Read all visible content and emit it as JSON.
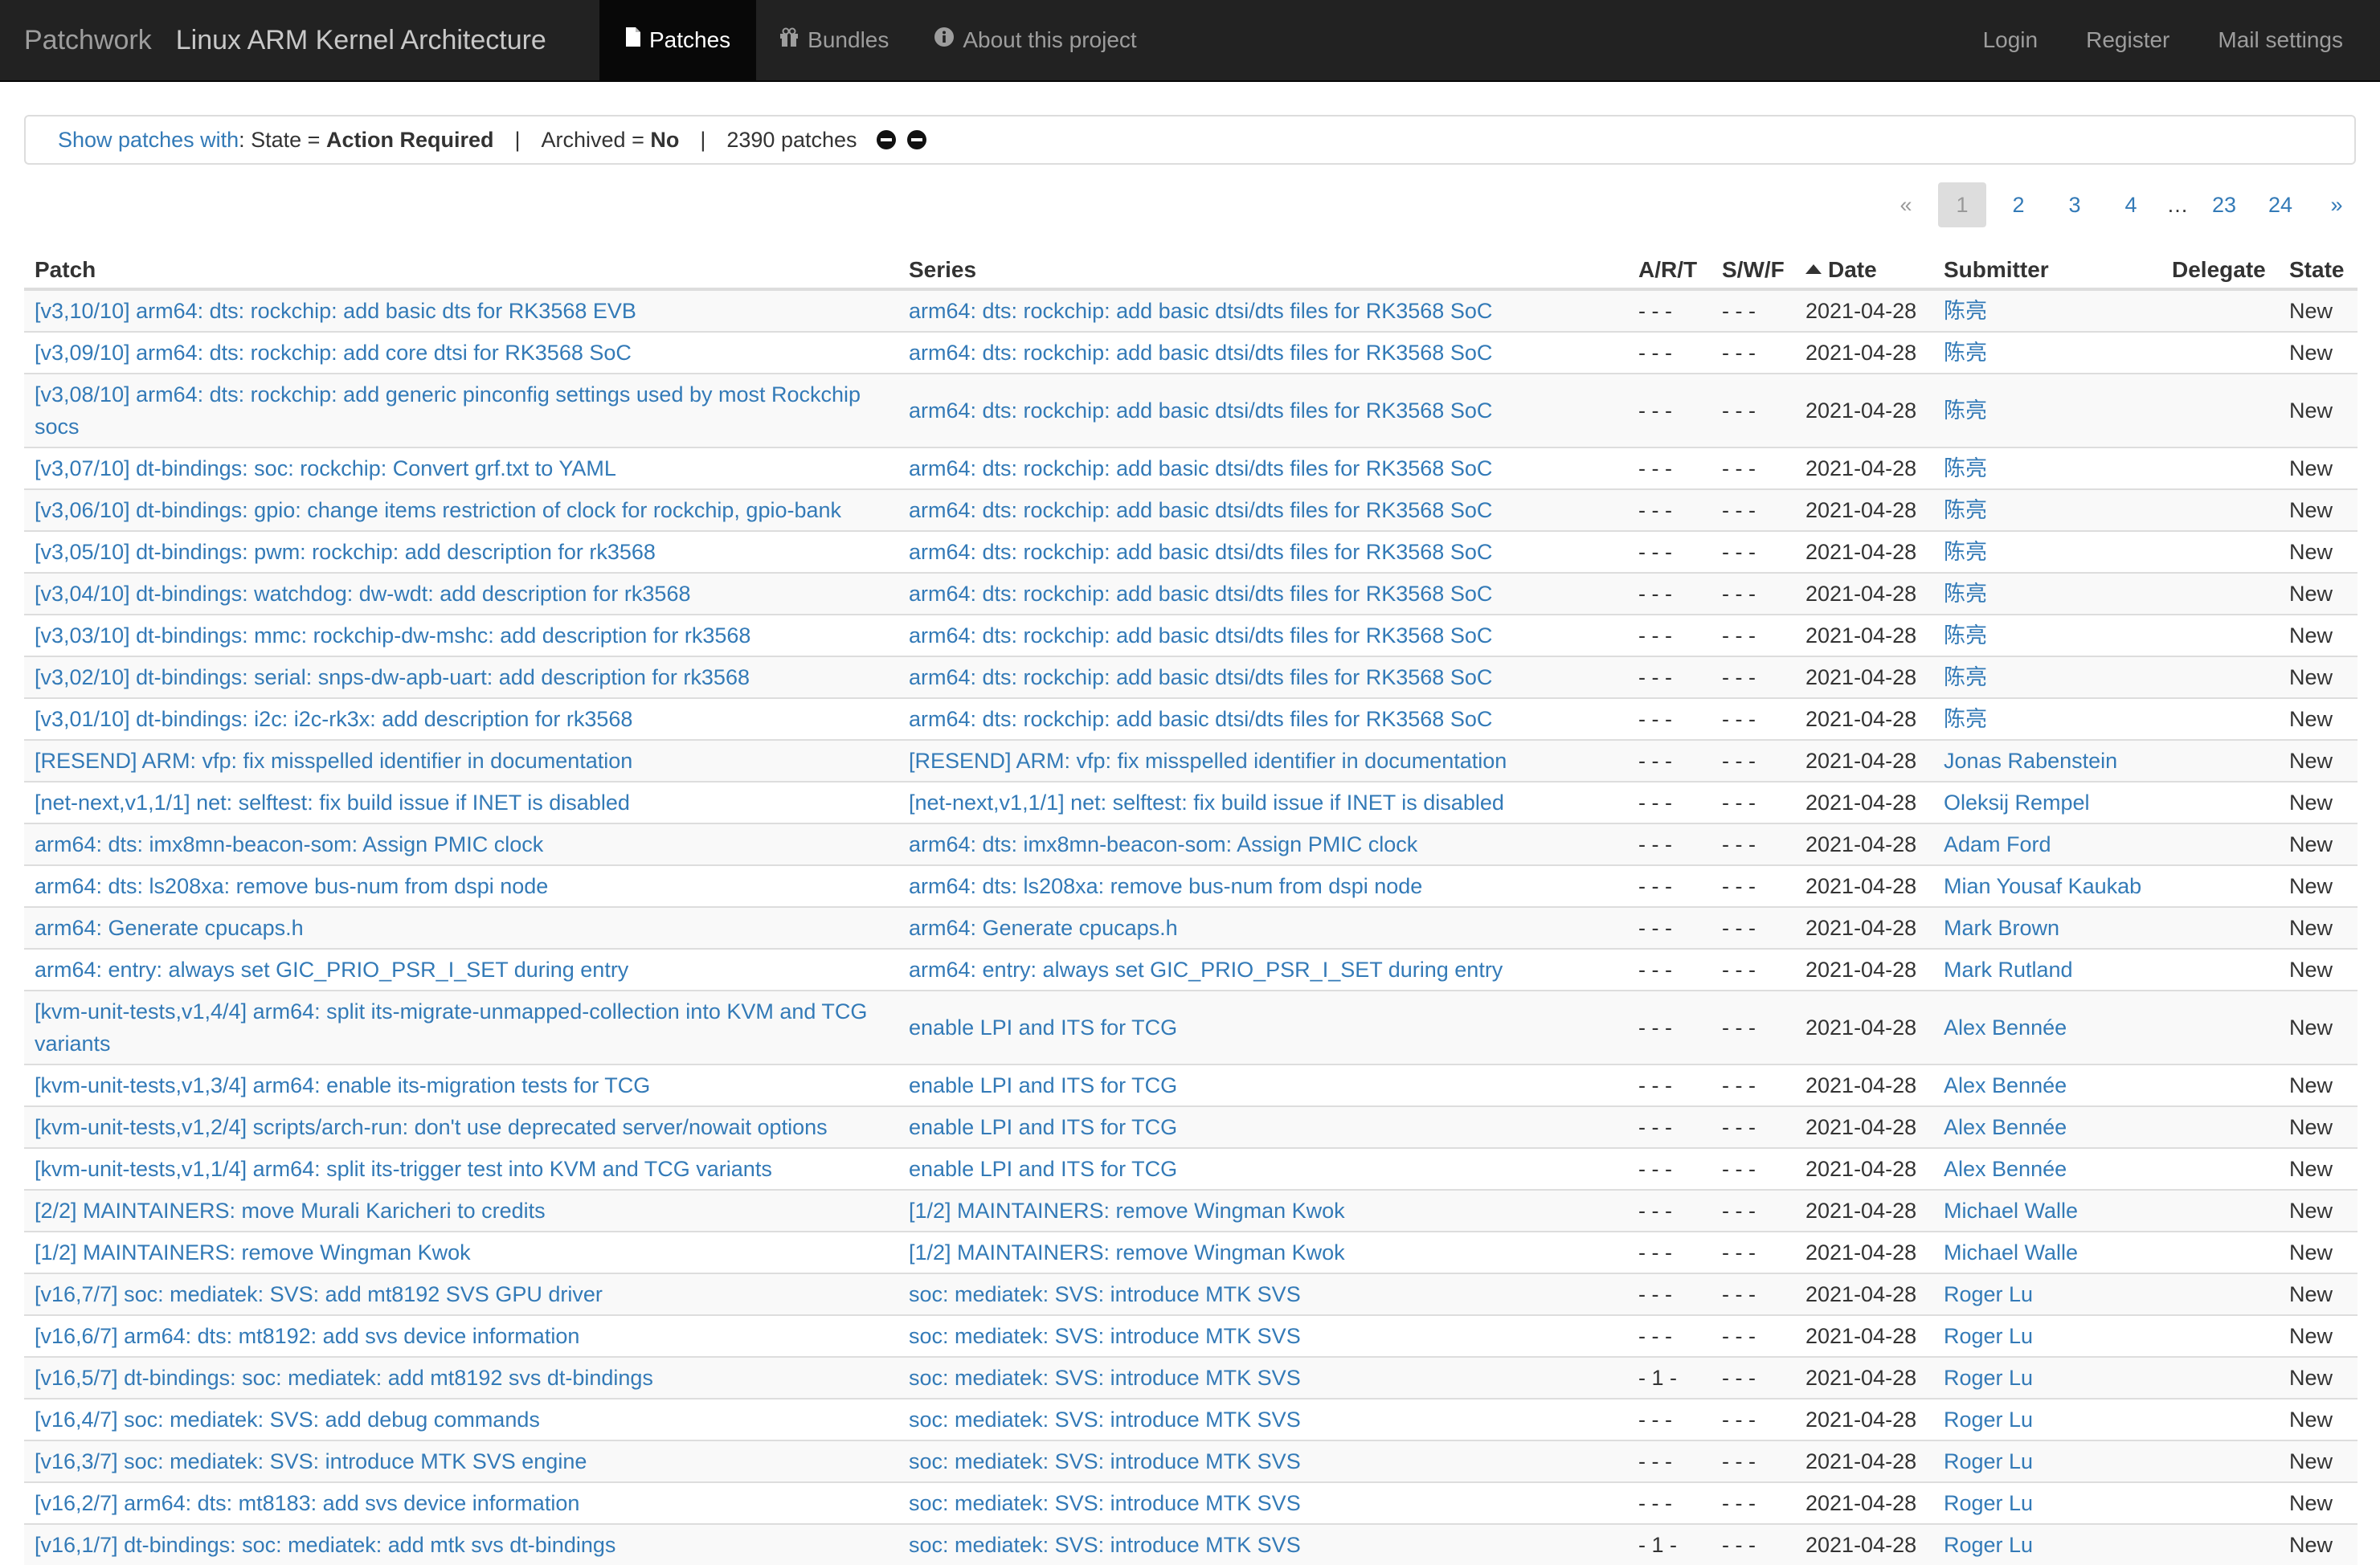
{
  "nav": {
    "site_name": "Patchwork",
    "project_name": "Linux ARM Kernel Architecture",
    "tabs": [
      {
        "label": "Patches",
        "icon": "file-icon",
        "active": true
      },
      {
        "label": "Bundles",
        "icon": "gift-icon",
        "active": false
      },
      {
        "label": "About this project",
        "icon": "info-icon",
        "active": false
      }
    ],
    "right": [
      {
        "label": "Login"
      },
      {
        "label": "Register"
      },
      {
        "label": "Mail settings"
      }
    ]
  },
  "filters": {
    "prefix": "Show patches with",
    "state_label": "State =",
    "state_value": "Action Required",
    "archived_label": "Archived =",
    "archived_value": "No",
    "count": "2390 patches"
  },
  "pagination": {
    "prev": "«",
    "pages": [
      "1",
      "2",
      "3",
      "4"
    ],
    "ellipsis": "…",
    "tail_pages": [
      "23",
      "24"
    ],
    "next": "»",
    "current": "1"
  },
  "table": {
    "headers": {
      "patch": "Patch",
      "series": "Series",
      "art": "A/R/T",
      "swf": "S/W/F",
      "date": "Date",
      "submitter": "Submitter",
      "delegate": "Delegate",
      "state": "State"
    },
    "rows": [
      {
        "patch": "[v3,10/10] arm64: dts: rockchip: add basic dts for RK3568 EVB",
        "series": "arm64: dts: rockchip: add basic dtsi/dts files for RK3568 SoC",
        "art": "- - -",
        "swf": "- - -",
        "date": "2021-04-28",
        "submitter": "陈亮",
        "delegate": "",
        "state": "New"
      },
      {
        "patch": "[v3,09/10] arm64: dts: rockchip: add core dtsi for RK3568 SoC",
        "series": "arm64: dts: rockchip: add basic dtsi/dts files for RK3568 SoC",
        "art": "- - -",
        "swf": "- - -",
        "date": "2021-04-28",
        "submitter": "陈亮",
        "delegate": "",
        "state": "New"
      },
      {
        "patch": "[v3,08/10] arm64: dts: rockchip: add generic pinconfig settings used by most Rockchip socs",
        "series": "arm64: dts: rockchip: add basic dtsi/dts files for RK3568 SoC",
        "art": "- - -",
        "swf": "- - -",
        "date": "2021-04-28",
        "submitter": "陈亮",
        "delegate": "",
        "state": "New"
      },
      {
        "patch": "[v3,07/10] dt-bindings: soc: rockchip: Convert grf.txt to YAML",
        "series": "arm64: dts: rockchip: add basic dtsi/dts files for RK3568 SoC",
        "art": "- - -",
        "swf": "- - -",
        "date": "2021-04-28",
        "submitter": "陈亮",
        "delegate": "",
        "state": "New"
      },
      {
        "patch": "[v3,06/10] dt-bindings: gpio: change items restriction of clock for rockchip, gpio-bank",
        "series": "arm64: dts: rockchip: add basic dtsi/dts files for RK3568 SoC",
        "art": "- - -",
        "swf": "- - -",
        "date": "2021-04-28",
        "submitter": "陈亮",
        "delegate": "",
        "state": "New"
      },
      {
        "patch": "[v3,05/10] dt-bindings: pwm: rockchip: add description for rk3568",
        "series": "arm64: dts: rockchip: add basic dtsi/dts files for RK3568 SoC",
        "art": "- - -",
        "swf": "- - -",
        "date": "2021-04-28",
        "submitter": "陈亮",
        "delegate": "",
        "state": "New"
      },
      {
        "patch": "[v3,04/10] dt-bindings: watchdog: dw-wdt: add description for rk3568",
        "series": "arm64: dts: rockchip: add basic dtsi/dts files for RK3568 SoC",
        "art": "- - -",
        "swf": "- - -",
        "date": "2021-04-28",
        "submitter": "陈亮",
        "delegate": "",
        "state": "New"
      },
      {
        "patch": "[v3,03/10] dt-bindings: mmc: rockchip-dw-mshc: add description for rk3568",
        "series": "arm64: dts: rockchip: add basic dtsi/dts files for RK3568 SoC",
        "art": "- - -",
        "swf": "- - -",
        "date": "2021-04-28",
        "submitter": "陈亮",
        "delegate": "",
        "state": "New"
      },
      {
        "patch": "[v3,02/10] dt-bindings: serial: snps-dw-apb-uart: add description for rk3568",
        "series": "arm64: dts: rockchip: add basic dtsi/dts files for RK3568 SoC",
        "art": "- - -",
        "swf": "- - -",
        "date": "2021-04-28",
        "submitter": "陈亮",
        "delegate": "",
        "state": "New"
      },
      {
        "patch": "[v3,01/10] dt-bindings: i2c: i2c-rk3x: add description for rk3568",
        "series": "arm64: dts: rockchip: add basic dtsi/dts files for RK3568 SoC",
        "art": "- - -",
        "swf": "- - -",
        "date": "2021-04-28",
        "submitter": "陈亮",
        "delegate": "",
        "state": "New"
      },
      {
        "patch": "[RESEND] ARM: vfp: fix misspelled identifier in documentation",
        "series": "[RESEND] ARM: vfp: fix misspelled identifier in documentation",
        "art": "- - -",
        "swf": "- - -",
        "date": "2021-04-28",
        "submitter": "Jonas Rabenstein",
        "delegate": "",
        "state": "New"
      },
      {
        "patch": "[net-next,v1,1/1] net: selftest: fix build issue if INET is disabled",
        "series": "[net-next,v1,1/1] net: selftest: fix build issue if INET is disabled",
        "art": "- - -",
        "swf": "- - -",
        "date": "2021-04-28",
        "submitter": "Oleksij Rempel",
        "delegate": "",
        "state": "New"
      },
      {
        "patch": "arm64: dts: imx8mn-beacon-som: Assign PMIC clock",
        "series": "arm64: dts: imx8mn-beacon-som: Assign PMIC clock",
        "art": "- - -",
        "swf": "- - -",
        "date": "2021-04-28",
        "submitter": "Adam Ford",
        "delegate": "",
        "state": "New"
      },
      {
        "patch": "arm64: dts: ls208xa: remove bus-num from dspi node",
        "series": "arm64: dts: ls208xa: remove bus-num from dspi node",
        "art": "- - -",
        "swf": "- - -",
        "date": "2021-04-28",
        "submitter": "Mian Yousaf Kaukab",
        "delegate": "",
        "state": "New"
      },
      {
        "patch": "arm64: Generate cpucaps.h",
        "series": "arm64: Generate cpucaps.h",
        "art": "- - -",
        "swf": "- - -",
        "date": "2021-04-28",
        "submitter": "Mark Brown",
        "delegate": "",
        "state": "New"
      },
      {
        "patch": "arm64: entry: always set GIC_PRIO_PSR_I_SET during entry",
        "series": "arm64: entry: always set GIC_PRIO_PSR_I_SET during entry",
        "art": "- - -",
        "swf": "- - -",
        "date": "2021-04-28",
        "submitter": "Mark Rutland",
        "delegate": "",
        "state": "New"
      },
      {
        "patch": "[kvm-unit-tests,v1,4/4] arm64: split its-migrate-unmapped-collection into KVM and TCG variants",
        "series": "enable LPI and ITS for TCG",
        "art": "- - -",
        "swf": "- - -",
        "date": "2021-04-28",
        "submitter": "Alex Bennée",
        "delegate": "",
        "state": "New"
      },
      {
        "patch": "[kvm-unit-tests,v1,3/4] arm64: enable its-migration tests for TCG",
        "series": "enable LPI and ITS for TCG",
        "art": "- - -",
        "swf": "- - -",
        "date": "2021-04-28",
        "submitter": "Alex Bennée",
        "delegate": "",
        "state": "New"
      },
      {
        "patch": "[kvm-unit-tests,v1,2/4] scripts/arch-run: don't use deprecated server/nowait options",
        "series": "enable LPI and ITS for TCG",
        "art": "- - -",
        "swf": "- - -",
        "date": "2021-04-28",
        "submitter": "Alex Bennée",
        "delegate": "",
        "state": "New"
      },
      {
        "patch": "[kvm-unit-tests,v1,1/4] arm64: split its-trigger test into KVM and TCG variants",
        "series": "enable LPI and ITS for TCG",
        "art": "- - -",
        "swf": "- - -",
        "date": "2021-04-28",
        "submitter": "Alex Bennée",
        "delegate": "",
        "state": "New"
      },
      {
        "patch": "[2/2] MAINTAINERS: move Murali Karicheri to credits",
        "series": "[1/2] MAINTAINERS: remove Wingman Kwok",
        "art": "- - -",
        "swf": "- - -",
        "date": "2021-04-28",
        "submitter": "Michael Walle",
        "delegate": "",
        "state": "New"
      },
      {
        "patch": "[1/2] MAINTAINERS: remove Wingman Kwok",
        "series": "[1/2] MAINTAINERS: remove Wingman Kwok",
        "art": "- - -",
        "swf": "- - -",
        "date": "2021-04-28",
        "submitter": "Michael Walle",
        "delegate": "",
        "state": "New"
      },
      {
        "patch": "[v16,7/7] soc: mediatek: SVS: add mt8192 SVS GPU driver",
        "series": "soc: mediatek: SVS: introduce MTK SVS",
        "art": "- - -",
        "swf": "- - -",
        "date": "2021-04-28",
        "submitter": "Roger Lu",
        "delegate": "",
        "state": "New"
      },
      {
        "patch": "[v16,6/7] arm64: dts: mt8192: add svs device information",
        "series": "soc: mediatek: SVS: introduce MTK SVS",
        "art": "- - -",
        "swf": "- - -",
        "date": "2021-04-28",
        "submitter": "Roger Lu",
        "delegate": "",
        "state": "New"
      },
      {
        "patch": "[v16,5/7] dt-bindings: soc: mediatek: add mt8192 svs dt-bindings",
        "series": "soc: mediatek: SVS: introduce MTK SVS",
        "art": "- 1 -",
        "swf": "- - -",
        "date": "2021-04-28",
        "submitter": "Roger Lu",
        "delegate": "",
        "state": "New"
      },
      {
        "patch": "[v16,4/7] soc: mediatek: SVS: add debug commands",
        "series": "soc: mediatek: SVS: introduce MTK SVS",
        "art": "- - -",
        "swf": "- - -",
        "date": "2021-04-28",
        "submitter": "Roger Lu",
        "delegate": "",
        "state": "New"
      },
      {
        "patch": "[v16,3/7] soc: mediatek: SVS: introduce MTK SVS engine",
        "series": "soc: mediatek: SVS: introduce MTK SVS",
        "art": "- - -",
        "swf": "- - -",
        "date": "2021-04-28",
        "submitter": "Roger Lu",
        "delegate": "",
        "state": "New"
      },
      {
        "patch": "[v16,2/7] arm64: dts: mt8183: add svs device information",
        "series": "soc: mediatek: SVS: introduce MTK SVS",
        "art": "- - -",
        "swf": "- - -",
        "date": "2021-04-28",
        "submitter": "Roger Lu",
        "delegate": "",
        "state": "New"
      },
      {
        "patch": "[v16,1/7] dt-bindings: soc: mediatek: add mtk svs dt-bindings",
        "series": "soc: mediatek: SVS: introduce MTK SVS",
        "art": "- 1 -",
        "swf": "- - -",
        "date": "2021-04-28",
        "submitter": "Roger Lu",
        "delegate": "",
        "state": "New"
      }
    ]
  }
}
